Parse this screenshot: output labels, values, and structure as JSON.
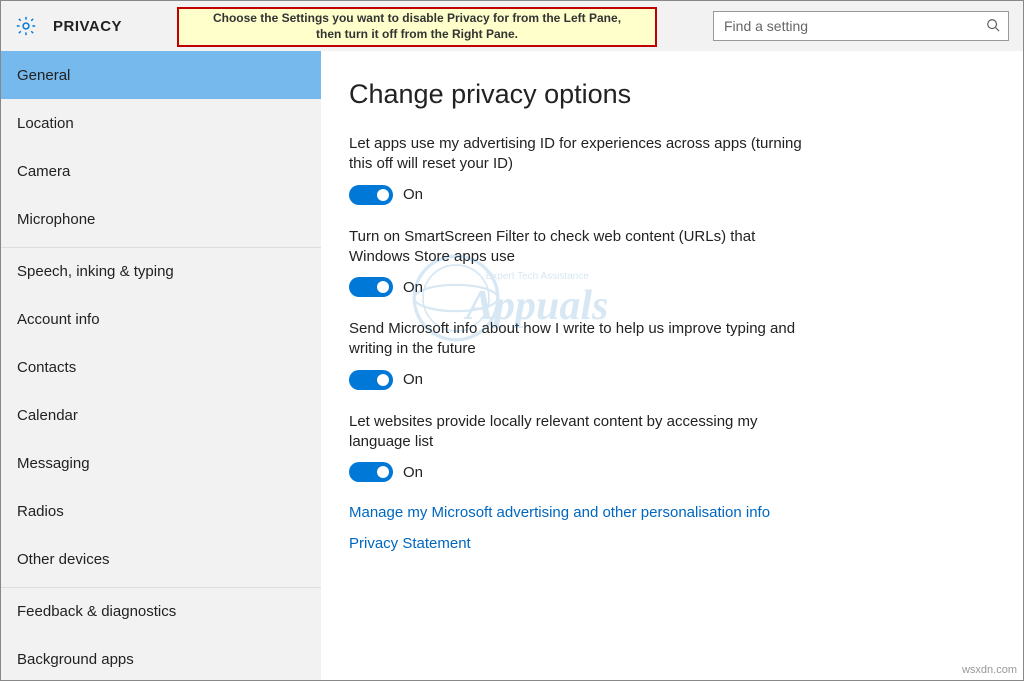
{
  "header": {
    "title": "PRIVACY"
  },
  "callout": {
    "text": "Choose the Settings you want to disable Privacy for from the Left Pane, then turn it off from the Right Pane."
  },
  "search": {
    "placeholder": "Find a setting"
  },
  "sidebar": {
    "items": [
      {
        "label": "General",
        "selected": true
      },
      {
        "label": "Location"
      },
      {
        "label": "Camera"
      },
      {
        "label": "Microphone"
      },
      {
        "label": "Speech, inking & typing",
        "divider": true
      },
      {
        "label": "Account info"
      },
      {
        "label": "Contacts"
      },
      {
        "label": "Calendar"
      },
      {
        "label": "Messaging"
      },
      {
        "label": "Radios"
      },
      {
        "label": "Other devices"
      },
      {
        "label": "Feedback & diagnostics",
        "divider": true
      },
      {
        "label": "Background apps"
      }
    ]
  },
  "content": {
    "heading": "Change privacy options",
    "settings": [
      {
        "desc": "Let apps use my advertising ID for experiences across apps (turning this off will reset your ID)",
        "state": "On"
      },
      {
        "desc": "Turn on SmartScreen Filter to check web content (URLs) that Windows Store apps use",
        "state": "On"
      },
      {
        "desc": "Send Microsoft info about how I write to help us improve typing and writing in the future",
        "state": "On"
      },
      {
        "desc": "Let websites provide locally relevant content by accessing my language list",
        "state": "On"
      }
    ],
    "links": [
      "Manage my Microsoft advertising and other personalisation info",
      "Privacy Statement"
    ]
  },
  "watermark": {
    "main": "Appuals",
    "sub": "Expert Tech Assistance"
  },
  "footer": "wsxdn.com"
}
